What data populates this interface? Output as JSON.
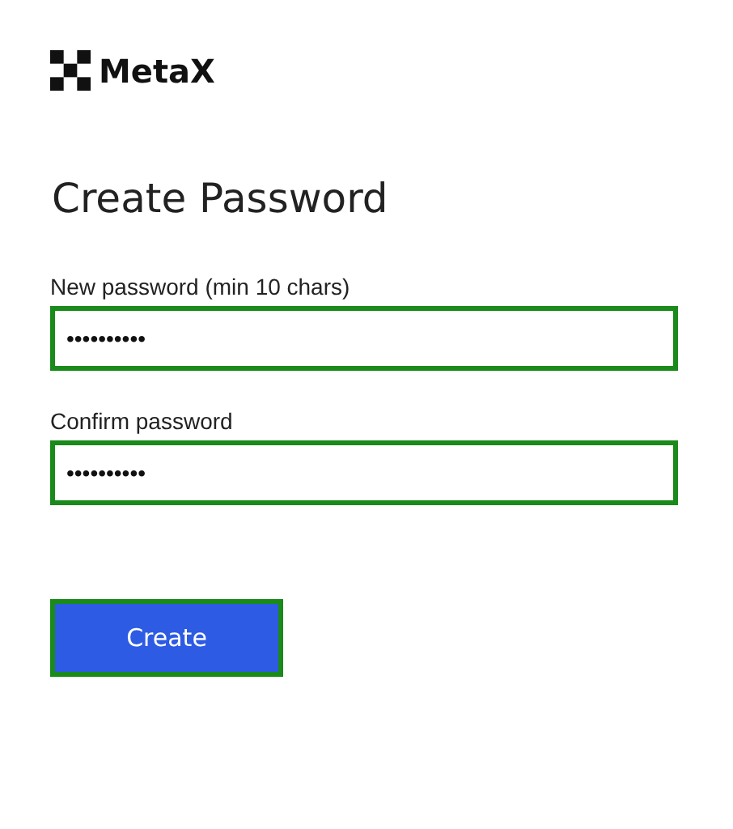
{
  "brand": {
    "name": "MetaX"
  },
  "heading": "Create Password",
  "fields": [
    {
      "label": "New password (min 10 chars)",
      "value": "••••••••••",
      "outlined": true
    },
    {
      "label": "Confirm password",
      "value": "••••••••••",
      "outlined": true
    }
  ],
  "button": {
    "label": "Create",
    "outlined": true
  }
}
